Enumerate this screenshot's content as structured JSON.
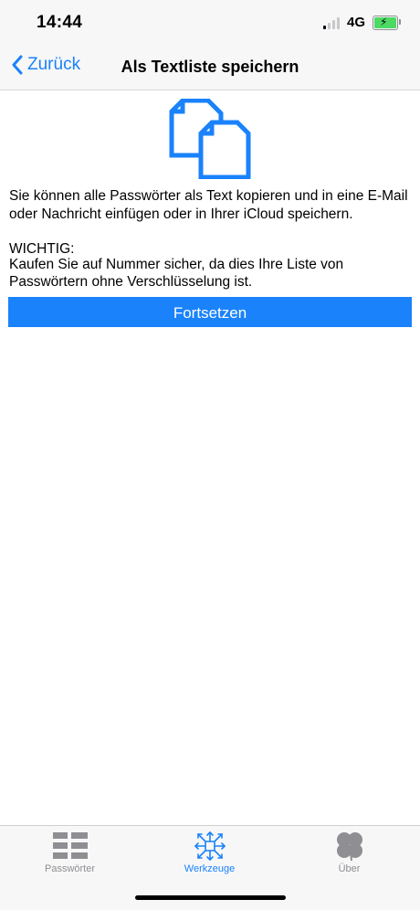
{
  "status": {
    "time": "14:44",
    "network": "4G"
  },
  "nav": {
    "back_label": "Zurück",
    "title": "Als Textliste speichern"
  },
  "content": {
    "description": "Sie können alle Passwörter als Text kopieren und in eine E-Mail oder Nachricht einfügen oder in Ihrer iCloud speichern.",
    "warning_heading": "WICHTIG:",
    "warning_text": "Kaufen Sie auf Nummer sicher, da dies Ihre Liste von Passwörtern ohne Verschlüsselung ist.",
    "continue_label": "Fortsetzen"
  },
  "tabs": [
    {
      "label": "Passwörter",
      "icon": "list-icon",
      "active": false
    },
    {
      "label": "Werkzeuge",
      "icon": "tools-icon",
      "active": true
    },
    {
      "label": "Über",
      "icon": "clover-icon",
      "active": false
    }
  ],
  "colors": {
    "accent": "#1a82fb",
    "inactive": "#8e8e93",
    "battery": "#4cd964"
  }
}
